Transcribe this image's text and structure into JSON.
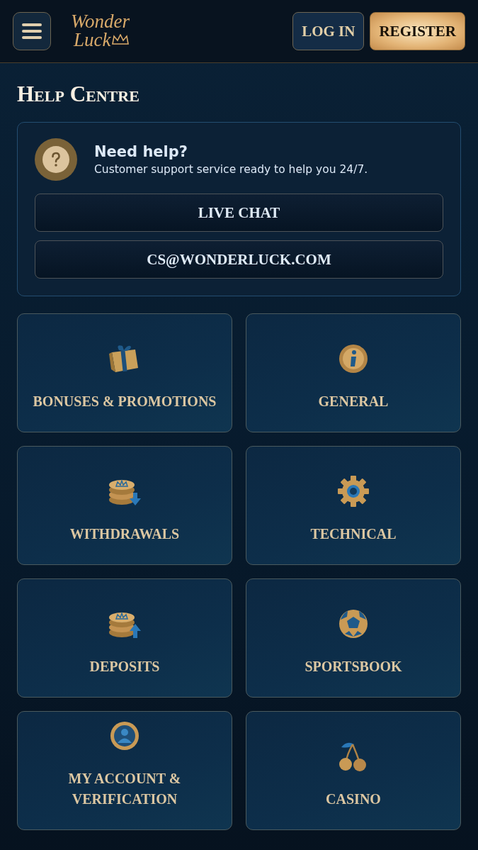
{
  "header": {
    "logo": [
      "Wonder",
      "Luck"
    ],
    "buttons": [
      {
        "label": "LOG IN",
        "kind": "secondary"
      },
      {
        "label": "REGISTER",
        "kind": "primary"
      }
    ]
  },
  "page_title": "Help Centre",
  "support": {
    "title": "Need help?",
    "text": "Customer support service ready to help you 24/7.",
    "buttons": [
      "LIVE CHAT",
      "CS@WONDERLUCK.COM"
    ]
  },
  "categories": [
    {
      "label": "BONUSES & PROMOTIONS",
      "kind": "gift"
    },
    {
      "label": "GENERAL",
      "kind": "info"
    },
    {
      "label": "WITHDRAWALS",
      "kind": "coins-down"
    },
    {
      "label": "TECHNICAL",
      "kind": "gear"
    },
    {
      "label": "DEPOSITS",
      "kind": "coins-up"
    },
    {
      "label": "SPORTSBOOK",
      "kind": "ball"
    },
    {
      "label": "MY ACCOUNT & VERIFICATION",
      "kind": "account"
    },
    {
      "label": "CASINO",
      "kind": "cherries"
    }
  ]
}
